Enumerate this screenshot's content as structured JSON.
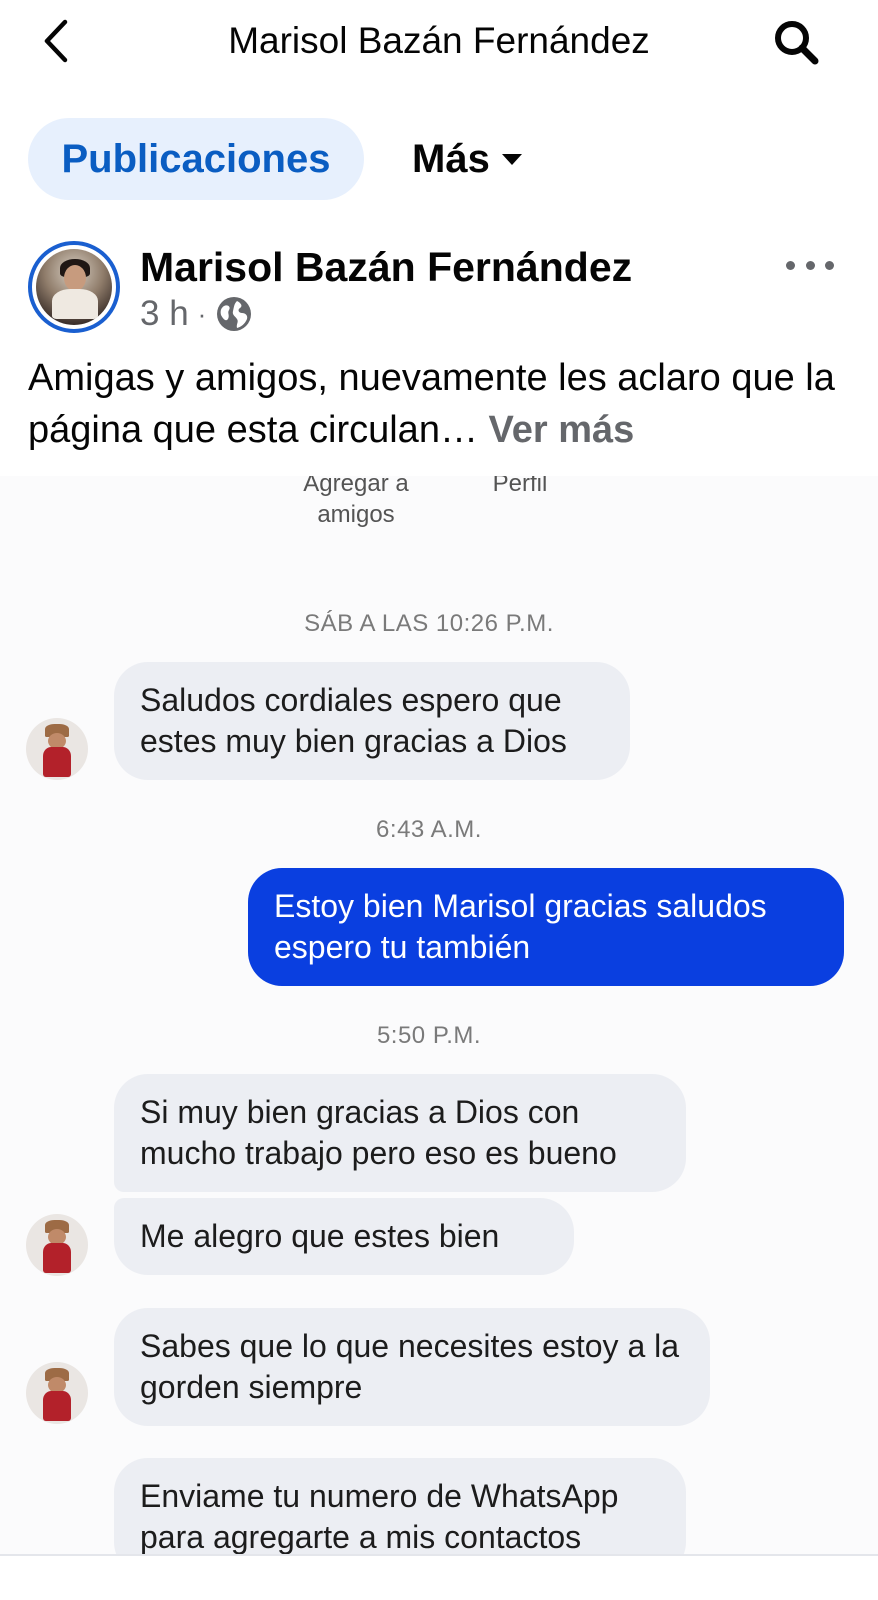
{
  "header": {
    "title": "Marisol Bazán Fernández",
    "back_icon": "chevron-left-icon",
    "search_icon": "search-icon"
  },
  "tabs": {
    "publicaciones": "Publicaciones",
    "mas": "Más"
  },
  "post": {
    "author": "Marisol Bazán Fernández",
    "time": "3 h",
    "separator": "·",
    "audience_icon": "globe-icon",
    "text": "Amigas y amigos, nuevamente les aclaro que la página que esta circulan…",
    "see_more": " Ver más"
  },
  "screenshot": {
    "top_labels": {
      "add_friends": "Agregar a amigos",
      "profile": "Perfil"
    },
    "messages": [
      {
        "type": "timestamp",
        "text": "SÁB A LAS 10:26 P.M."
      },
      {
        "type": "incoming",
        "text": "Saludos cordiales espero que estes muy bien gracias a Dios"
      },
      {
        "type": "timestamp",
        "text": "6:43 A.M."
      },
      {
        "type": "outgoing",
        "text": "Estoy bien Marisol gracias saludos espero tu también"
      },
      {
        "type": "timestamp",
        "text": "5:50 P.M."
      },
      {
        "type": "incoming",
        "text": "Si muy  bien gracias a Dios con mucho trabajo pero eso es bueno"
      },
      {
        "type": "incoming",
        "text": "Me alegro que  estes  bien"
      },
      {
        "type": "incoming",
        "text": "Sabes que lo que necesites estoy a la gorden siempre"
      },
      {
        "type": "incoming",
        "text": "Enviame tu numero de WhatsApp para agregarte a mis contactos"
      }
    ]
  },
  "colors": {
    "tab_active_bg": "#e7f0fd",
    "tab_active_text": "#0a5dc2",
    "outgoing_bubble": "#0a3fe0",
    "incoming_bubble": "#eceef3",
    "avatar_ring": "#1a5fd0"
  }
}
